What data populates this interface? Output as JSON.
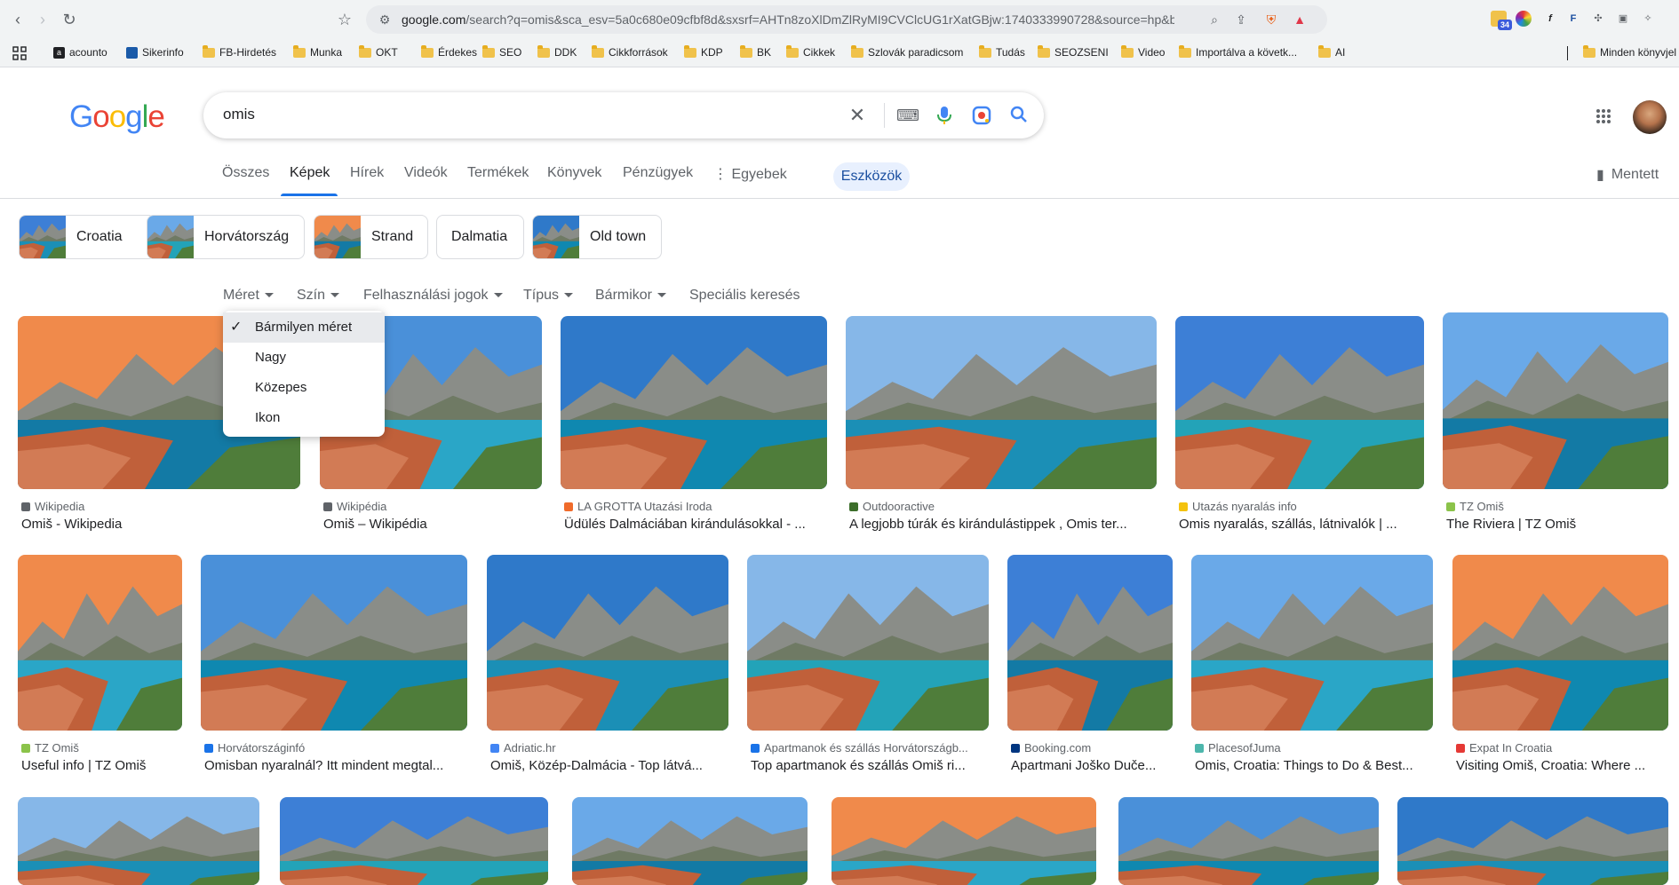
{
  "browser": {
    "url_host": "google.com",
    "url_rest": "/search?q=omis&sca_esv=5a0c680e09cfbf8d&sxsrf=AHTn8zoXlDmZlRyMI9CVClcUG1rXatGBjw:1740333990728&source=hp&biw=...",
    "extension_badge": "34",
    "shield_badge": "4"
  },
  "bookmarks": [
    {
      "label": "acounto",
      "icon": "acounto-icon"
    },
    {
      "label": "Sikerinfo",
      "icon": "sikerinfo-icon"
    },
    {
      "label": "FB-Hirdetés",
      "icon": "folder-icon"
    },
    {
      "label": "Munka",
      "icon": "folder-icon"
    },
    {
      "label": "OKT",
      "icon": "folder-icon"
    },
    {
      "label": "Érdekes",
      "icon": "folder-icon"
    },
    {
      "label": "SEO",
      "icon": "folder-icon"
    },
    {
      "label": "DDK",
      "icon": "folder-icon"
    },
    {
      "label": "Cikkforrások",
      "icon": "folder-icon"
    },
    {
      "label": "KDP",
      "icon": "folder-icon"
    },
    {
      "label": "BK",
      "icon": "folder-icon"
    },
    {
      "label": "Cikkek",
      "icon": "folder-icon"
    },
    {
      "label": "Szlovák paradicsom",
      "icon": "folder-icon"
    },
    {
      "label": "Tudás",
      "icon": "folder-icon"
    },
    {
      "label": "SEOZSENI",
      "icon": "folder-icon"
    },
    {
      "label": "Video",
      "icon": "folder-icon"
    },
    {
      "label": "Importálva a követk...",
      "icon": "folder-icon"
    },
    {
      "label": "AI",
      "icon": "folder-icon"
    },
    {
      "label": "Minden könyvjel",
      "icon": "folder-icon"
    }
  ],
  "google": {
    "logo": "Google",
    "query": "omis",
    "tabs": [
      "Összes",
      "Képek",
      "Hírek",
      "Videók",
      "Termékek",
      "Könyvek",
      "Pénzügyek",
      "Egyebek"
    ],
    "active_tab": "Képek",
    "tools": "Eszközök",
    "saved": "Mentett"
  },
  "chips": [
    "Croatia",
    "Horvátország",
    "Strand",
    "Dalmatia",
    "Old town"
  ],
  "filters": [
    "Méret",
    "Szín",
    "Felhasználási jogok",
    "Típus",
    "Bármikor",
    "Speciális keresés"
  ],
  "size_menu": {
    "items": [
      "Bármilyen méret",
      "Nagy",
      "Közepes",
      "Ikon"
    ],
    "selected": "Bármilyen méret"
  },
  "results": [
    {
      "source": "Wikipedia",
      "title": "Omiš - Wikipedia"
    },
    {
      "source": "Wikipédia",
      "title": "Omiš – Wikipédia"
    },
    {
      "source": "LA GROTTA Utazási Iroda",
      "title": "Üdülés Dalmáciában kirándulásokkal - ..."
    },
    {
      "source": "Outdooractive",
      "title": "A legjobb túrák és kirándulástippek , Omis ter..."
    },
    {
      "source": "Utazás nyaralás info",
      "title": "Omis nyaralás, szállás, látnivalók | ..."
    },
    {
      "source": "TZ Omiš",
      "title": "The Riviera | TZ Omiš"
    },
    {
      "source": "TZ Omiš",
      "title": "Useful info | TZ Omiš"
    },
    {
      "source": "Horvátországinfó",
      "title": "Omisban nyaralnál? Itt mindent megtal..."
    },
    {
      "source": "Adriatic.hr",
      "title": "Omiš, Közép-Dalmácia - Top látvá..."
    },
    {
      "source": "Apartmanok és szállás Horvátországb...",
      "title": "Top apartmanok és szállás Omiš ri..."
    },
    {
      "source": "Booking.com",
      "title": "Apartmani Joško Duče..."
    },
    {
      "source": "PlacesofJuma",
      "title": "Omis, Croatia: Things to Do & Best..."
    },
    {
      "source": "Expat In Croatia",
      "title": "Visiting Omiš, Croatia: Where ..."
    }
  ],
  "colors": {
    "accent": "#1a73e8",
    "tools_bg": "#e8f0fe",
    "sea": "#1a8fb8",
    "roofs": "#c0603a",
    "mountain": "#7c7f7d",
    "sky": "#4a90d9"
  }
}
